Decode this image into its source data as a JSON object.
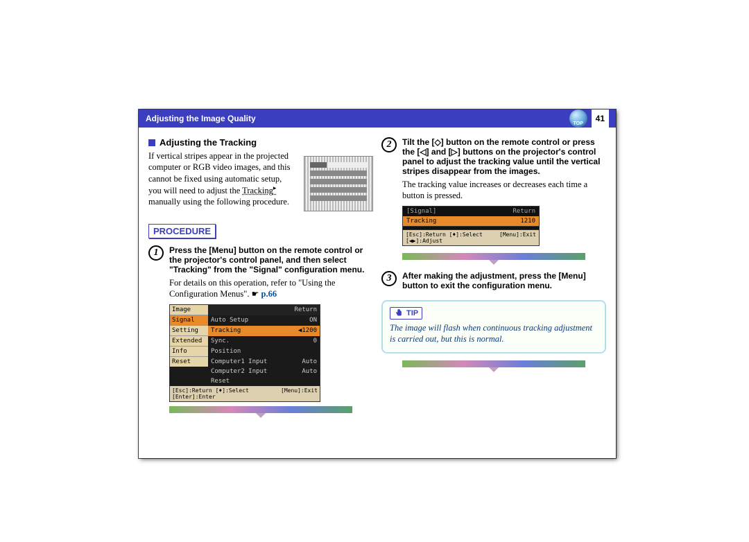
{
  "header": {
    "title": "Adjusting the Image Quality",
    "page_number": "41",
    "top_icon_label": "TOP"
  },
  "section": {
    "heading": "Adjusting the Tracking",
    "intro": "If vertical stripes appear in the projected computer or RGB video images, and this cannot be fixed using automatic setup, you will need to adjust the ",
    "tracking_term": "Tracking",
    "intro_tail": " manually using the following procedure.",
    "procedure_label": "PROCEDURE"
  },
  "steps": {
    "1": {
      "num": "1",
      "bold": "Press the [Menu] button on the remote control or the projector's control panel, and then select \"Tracking\" from the \"Signal\" configuration menu.",
      "body": "For details on this operation, refer to \"Using the Configuration Menus\". ",
      "ref": "p.66"
    },
    "2": {
      "num": "2",
      "bold": "Tilt the [◇] button on the remote control or press the [◁] and [▷] buttons on the projector's control panel to adjust the tracking value until the vertical stripes disappear from the images.",
      "body": "The tracking value increases or decreases each time a button is pressed."
    },
    "3": {
      "num": "3",
      "bold": "After making the adjustment, press the [Menu] button to exit the configuration menu."
    }
  },
  "menu_screenshot": {
    "return_label": "Return",
    "left_items": [
      "Image",
      "Signal",
      "Setting",
      "Extended",
      "Info",
      "Reset"
    ],
    "right_items": [
      {
        "label": "Auto Setup",
        "val": "ON"
      },
      {
        "label": "Tracking",
        "val": "◀1200"
      },
      {
        "label": "Sync.",
        "val": "0"
      },
      {
        "label": "Position",
        "val": ""
      },
      {
        "label": "Computer1 Input",
        "val": "Auto"
      },
      {
        "label": "Computer2 Input",
        "val": "Auto"
      },
      {
        "label": "Reset",
        "val": ""
      }
    ],
    "footer_left": "[Esc]:Return [♦]:Select [Enter]:Enter",
    "footer_right": "[Menu]:Exit"
  },
  "tracking_screenshot": {
    "top_left": "[Signal]",
    "top_right": "Return",
    "row_label": "Tracking",
    "row_value": "1210",
    "footer_left": "[Esc]:Return [♦]:Select [◀▶]:Adjust",
    "footer_right": "[Menu]:Exit"
  },
  "tip": {
    "label": "TIP",
    "text": "The image will flash when continuous tracking adjustment is carried out, but this is normal."
  }
}
